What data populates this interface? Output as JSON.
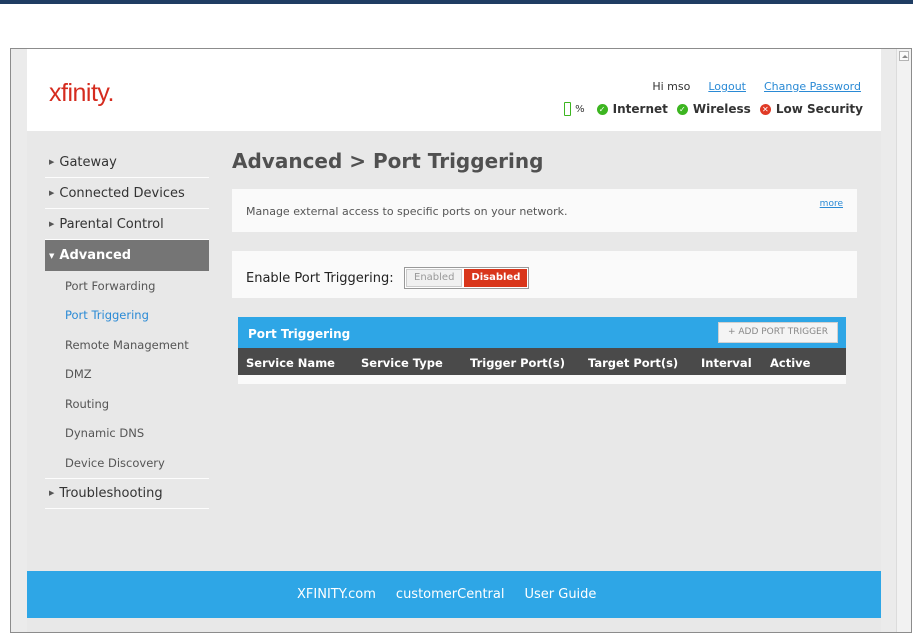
{
  "brand": {
    "logo_text": "xfinity."
  },
  "header": {
    "greeting": "Hi mso",
    "logout": "Logout",
    "change_password": "Change Password",
    "battery_percent": "%",
    "status": {
      "internet": "Internet",
      "wireless": "Wireless",
      "security": "Low Security"
    }
  },
  "sidebar": {
    "items": [
      {
        "label": "Gateway"
      },
      {
        "label": "Connected Devices"
      },
      {
        "label": "Parental Control"
      },
      {
        "label": "Advanced"
      }
    ],
    "sub_items": [
      {
        "label": "Port Forwarding"
      },
      {
        "label": "Port Triggering"
      },
      {
        "label": "Remote Management"
      },
      {
        "label": "DMZ"
      },
      {
        "label": "Routing"
      },
      {
        "label": "Dynamic DNS"
      },
      {
        "label": "Device Discovery"
      }
    ],
    "last_item": {
      "label": "Troubleshooting"
    }
  },
  "main": {
    "title": "Advanced > Port Triggering",
    "description": "Manage external access to specific ports on your network.",
    "more_link": "more",
    "enable_label": "Enable Port Triggering:",
    "toggle_enabled": "Enabled",
    "toggle_disabled": "Disabled",
    "table": {
      "title": "Port Triggering",
      "add_button": "+ ADD PORT TRIGGER",
      "columns": [
        "Service Name",
        "Service Type",
        "Trigger Port(s)",
        "Target Port(s)",
        "Interval",
        "Active"
      ]
    }
  },
  "footer": {
    "links": [
      "XFINITY.com",
      "customerCentral",
      "User Guide"
    ]
  },
  "colors": {
    "accent_blue": "#2ea6e6",
    "brand_red": "#d52b1e",
    "disabled_red": "#d9361b",
    "ok_green": "#3cb520"
  }
}
